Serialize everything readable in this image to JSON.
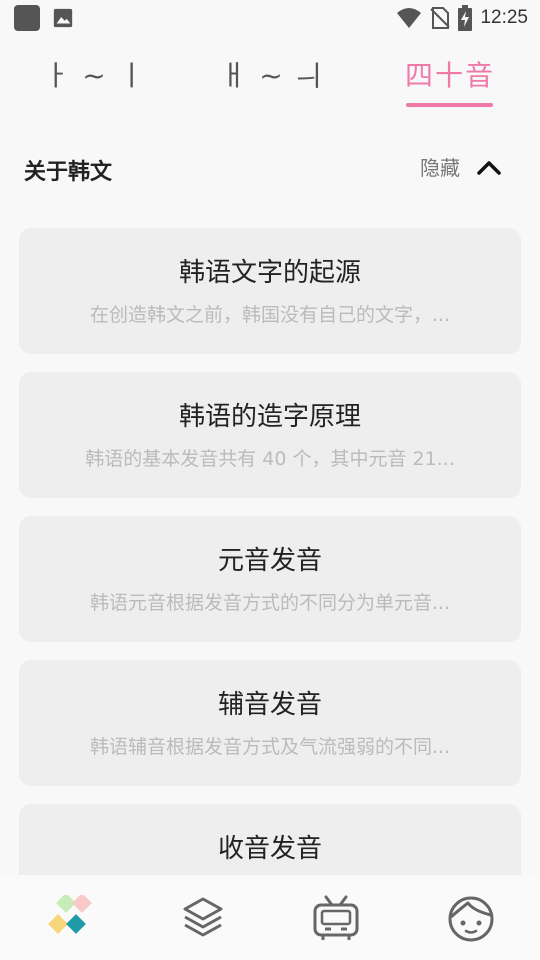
{
  "status_bar": {
    "time": "12:25"
  },
  "tabs": [
    {
      "label": "ㅏ ~ ㅣ",
      "active": false
    },
    {
      "label": "ㅐ ~ ㅢ",
      "active": false
    },
    {
      "label": "四十音",
      "active": true
    }
  ],
  "section": {
    "title": "关于韩文",
    "toggle_label": "隐藏"
  },
  "cards": [
    {
      "title": "韩语文字的起源",
      "subtitle": "在创造韩文之前，韩国没有自己的文字，..."
    },
    {
      "title": "韩语的造字原理",
      "subtitle": "韩语的基本发音共有 40 个，其中元音 21..."
    },
    {
      "title": "元音发音",
      "subtitle": "韩语元音根据发音方式的不同分为单元音..."
    },
    {
      "title": "辅音发音",
      "subtitle": "韩语辅音根据发音方式及气流强弱的不同..."
    },
    {
      "title": "收音发音",
      "subtitle": ""
    }
  ],
  "bottom_nav": [
    {
      "icon": "home-grid-icon",
      "active": true
    },
    {
      "icon": "layers-icon",
      "active": false
    },
    {
      "icon": "tv-icon",
      "active": false
    },
    {
      "icon": "profile-face-icon",
      "active": false
    }
  ],
  "colors": {
    "accent": "#f07aa7",
    "card_bg": "#eeeeee",
    "subtitle": "#bbbbbb"
  }
}
